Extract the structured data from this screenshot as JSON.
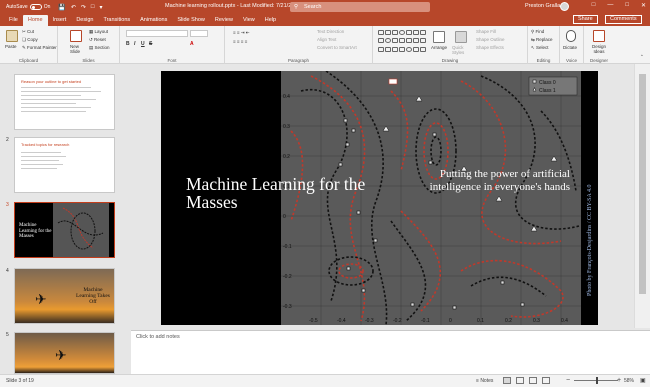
{
  "titlebar": {
    "autosave_label": "AutoSave",
    "autosave_state": "On",
    "doc_title": "Machine learning rollout.pptx  -  Last Modified: 7/21/2020",
    "search_placeholder": "Search",
    "user_name": "Preston Gralla"
  },
  "tabs": [
    "File",
    "Home",
    "Insert",
    "Design",
    "Transitions",
    "Animations",
    "Slide Show",
    "Review",
    "View",
    "Help"
  ],
  "active_tab": "Home",
  "share_label": "Share",
  "comments_label": "Comments",
  "ribbon": {
    "clipboard": {
      "paste": "Paste",
      "cut": "Cut",
      "copy": "Copy",
      "format_painter": "Format Painter",
      "label": "Clipboard"
    },
    "slides": {
      "new_slide": "New Slide",
      "layout": "Layout",
      "reset": "Reset",
      "section": "Section",
      "label": "Slides"
    },
    "font": {
      "label": "Font",
      "bold": "B",
      "italic": "I",
      "underline": "U",
      "strike": "S"
    },
    "paragraph": {
      "text_direction": "Text Direction",
      "align_text": "Align Text",
      "convert_smartart": "Convert to SmartArt",
      "label": "Paragraph"
    },
    "drawing": {
      "arrange": "Arrange",
      "quick_styles": "Quick Styles",
      "shape_fill": "Shape Fill",
      "shape_outline": "Shape Outline",
      "shape_effects": "Shape Effects",
      "label": "Drawing"
    },
    "editing": {
      "find": "Find",
      "replace": "Replace",
      "select": "Select",
      "label": "Editing"
    },
    "voice": {
      "dictate": "Dictate",
      "label": "Voice"
    },
    "designer": {
      "design_ideas": "Design Ideas",
      "label": "Designer"
    }
  },
  "thumbnails": [
    {
      "num": "",
      "title": "Reason your outline to get started"
    },
    {
      "num": "2",
      "title": "Tracked topics for research"
    },
    {
      "num": "3",
      "title": "Machine Learning for the Masses"
    },
    {
      "num": "4",
      "title": "Machine Learning Takes Off"
    },
    {
      "num": "5",
      "title": ""
    }
  ],
  "slide": {
    "title": "Machine Learning for the Masses",
    "subtitle": "Putting the power of artificial intelligence in everyone's hands",
    "credit": "Photo by François-Desjardins / CC BY-SA 4.0",
    "legend": [
      "Class 0",
      "Class 1"
    ],
    "y_ticks": [
      "0.4",
      "0.3",
      "0.2",
      "0.1",
      "0",
      "-0.1",
      "-0.2",
      "-0.3"
    ],
    "x_ticks": [
      "-0.5",
      "-0.4",
      "-0.3",
      "-0.2",
      "-0.1",
      "0",
      "0.1",
      "0.2",
      "0.3",
      "0.4"
    ]
  },
  "notes_placeholder": "Click to add notes",
  "status": {
    "slide_info": "Slide 3 of 19",
    "notes": "Notes",
    "zoom": "58%"
  },
  "colors": {
    "brand": "#b7472a",
    "selected": "#c43e1c",
    "class0": "#111111",
    "class1": "#c0392b"
  }
}
